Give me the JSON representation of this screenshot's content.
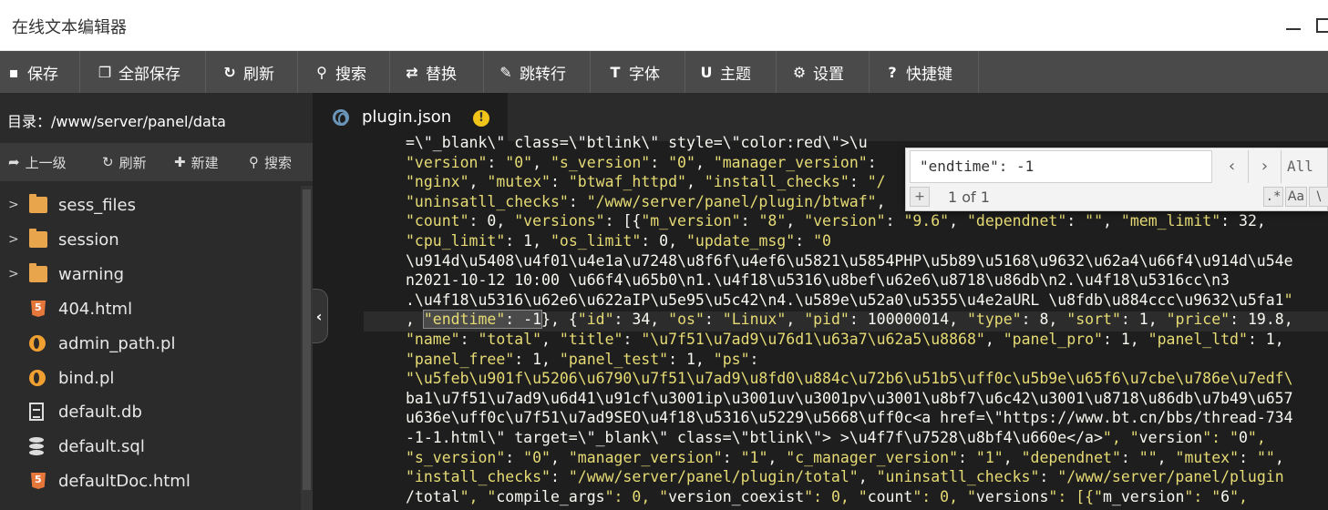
{
  "window": {
    "title": "在线文本编辑器"
  },
  "toolbar": {
    "save": "保存",
    "save_all": "全部保存",
    "refresh": "刷新",
    "search": "搜索",
    "replace": "替换",
    "goto_line": "跳转行",
    "font": "字体",
    "theme": "主题",
    "settings": "设置",
    "shortcuts": "快捷键"
  },
  "sidebar": {
    "directory_label": "目录：",
    "directory_path": "/www/server/panel/data",
    "actions": {
      "up": "上一级",
      "refresh": "刷新",
      "new": "新建",
      "search": "搜索"
    },
    "files": [
      {
        "name": "sess_files",
        "type": "folder"
      },
      {
        "name": "session",
        "type": "folder"
      },
      {
        "name": "warning",
        "type": "folder"
      },
      {
        "name": "404.html",
        "type": "html"
      },
      {
        "name": "admin_path.pl",
        "type": "perl"
      },
      {
        "name": "bind.pl",
        "type": "perl"
      },
      {
        "name": "default.db",
        "type": "doc"
      },
      {
        "name": "default.sql",
        "type": "db"
      },
      {
        "name": "defaultDoc.html",
        "type": "html"
      }
    ]
  },
  "editor": {
    "tab_name": "plugin.json",
    "code_lines": [
      "=\\\"_blank\\\" class=\\\"btlink\\\" style=\\\"color:red\\\">\\u",
      "\"version\": \"0\", \"s_version\": \"0\", \"manager_version\":",
      "\"nginx\", \"mutex\": \"btwaf_httpd\", \"install_checks\": \"/",
      "\"uninsatll_checks\": \"/www/server/panel/plugin/btwaf\",",
      "\"count\": 0, \"versions\": [{\"m_version\": \"8\", \"version\": \"9.6\", \"dependnet\": \"\", \"mem_limit\": 32,",
      "\"cpu_limit\": 1, \"os_limit\": 0, \"update_msg\": \"0",
      "\\u914d\\u5408\\u4f01\\u4e1a\\u7248\\u8f6f\\u4ef6\\u5821\\u5854PHP\\u5b89\\u5168\\u9632\\u62a4\\u66f4\\u914d\\u54e",
      "n2021-10-12 10:00 \\u66f4\\u65b0\\n1.\\u4f18\\u5316\\u8bef\\u62e6\\u8718\\u86db\\n2.\\u4f18\\u5316cc\\n3",
      ".\\u4f18\\u5316\\u62e6\\u622aIP\\u5e95\\u5c42\\n4.\\u589e\\u52a0\\u5355\\u4e2aURL \\u8fdb\\u884ccc\\u9632\\u5fa1\"",
      ", \"endtime\": -1}, {\"id\": 34, \"os\": \"Linux\", \"pid\": 100000014, \"type\": 8, \"sort\": 1, \"price\": 19.8,",
      "\"name\": \"total\", \"title\": \"\\u7f51\\u7ad9\\u76d1\\u63a7\\u62a5\\u8868\", \"panel_pro\": 1, \"panel_ltd\": 1,",
      "\"panel_free\": 1, \"panel_test\": 1, \"ps\":",
      "\"\\u5feb\\u901f\\u5206\\u6790\\u7f51\\u7ad9\\u8fd0\\u884c\\u72b6\\u51b5\\uff0c\\u5b9e\\u65f6\\u7cbe\\u786e\\u7edf\\",
      "ba1\\u7f51\\u7ad9\\u6d41\\u91cf\\u3001ip\\u3001uv\\u3001pv\\u3001\\u8bf7\\u6c42\\u3001\\u8718\\u86db\\u7b49\\u657",
      "u636e\\uff0c\\u7f51\\u7ad9SEO\\u4f18\\u5316\\u5229\\u5668\\uff0c<a href=\\\"https://www.bt.cn/bbs/thread-734",
      "-1-1.html\\\" target=\\\"_blank\\\" class=\\\"btlink\\\"> >\\u4f7f\\u7528\\u8bf4\\u660e</a>\", \"version\": \"0\",",
      "\"s_version\": \"0\", \"manager_version\": \"1\", \"c_manager_version\": \"1\", \"dependnet\": \"\", \"mutex\": \"\",",
      "\"install_checks\": \"/www/server/panel/plugin/total\", \"uninsatll_checks\": \"/www/server/panel/plugin",
      "/total\", \"compile_args\": 0, \"version_coexist\": 0, \"count\": 0, \"versions\": [{\"m_version\": \"6\","
    ],
    "match_text": "\"endtime\": -1"
  },
  "find": {
    "query": "\"endtime\": -1",
    "count": "1 of 1",
    "all_label": "All",
    "plus": "+",
    "regex": ".*",
    "case": "Aa",
    "word": "\\"
  },
  "colors": {
    "toolbar_bg": "#4a4a4a",
    "sidebar_bg": "#2b2b2b",
    "editor_bg": "#1e1e1e",
    "string": "#e6db74",
    "folder": "#e8a54b"
  }
}
